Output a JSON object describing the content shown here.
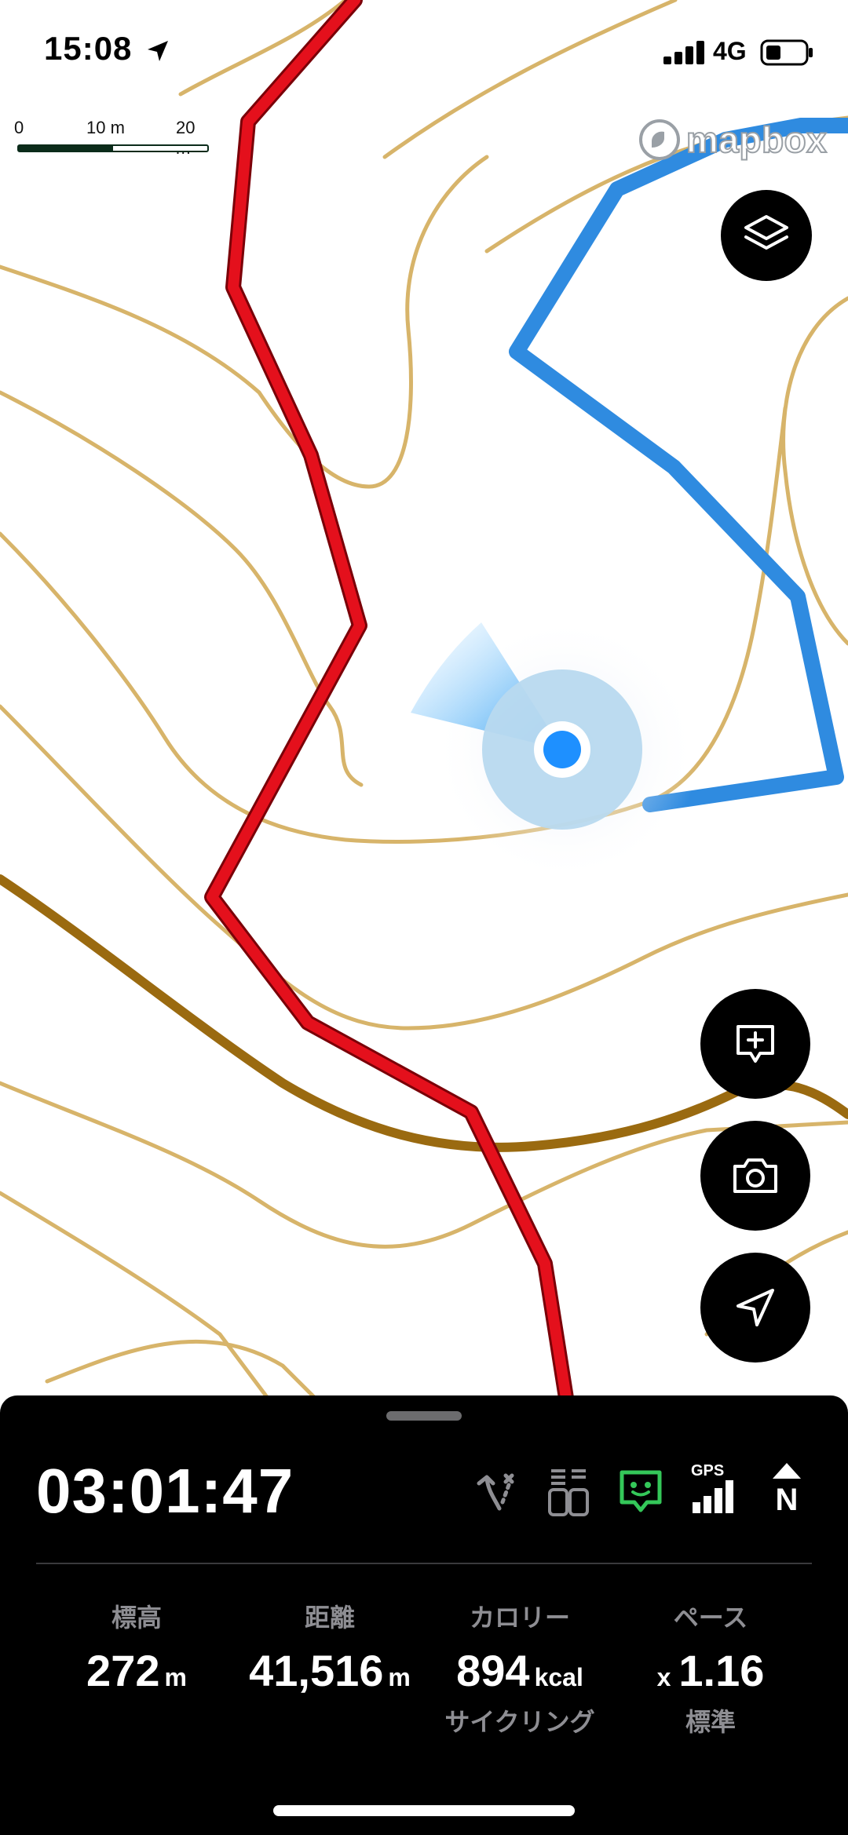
{
  "status": {
    "time": "15:08",
    "network": "4G"
  },
  "map": {
    "scale": {
      "labels": [
        "0",
        "10 m",
        "20 m"
      ]
    },
    "attribution": "mapbox",
    "colors": {
      "route_red": "#e4101c",
      "track_blue": "#2f8be0",
      "contour": "#d7b46a",
      "contour_major": "#9a6a10",
      "location": "#1e90ff"
    }
  },
  "controls": {
    "layers_icon": "layers-icon",
    "add_note_icon": "add-note-icon",
    "camera_icon": "camera-icon",
    "locate_icon": "navigation-arrow-icon"
  },
  "panel": {
    "elapsed": "03:01:47",
    "indicators": [
      "route-branch-icon",
      "battery-cells-icon",
      "assist-face-icon",
      "gps-signal-icon",
      "north-up-icon"
    ],
    "gps_label": "GPS",
    "north_label": "N",
    "stats": {
      "altitude": {
        "label": "標高",
        "value": "272",
        "unit": "m"
      },
      "distance": {
        "label": "距離",
        "value": "41,516",
        "unit": "m"
      },
      "calories": {
        "label": "カロリー",
        "value": "894",
        "unit": "kcal",
        "sub": "サイクリング"
      },
      "pace": {
        "label": "ペース",
        "prefix": "x",
        "value": "1.16",
        "sub": "標準"
      }
    }
  }
}
